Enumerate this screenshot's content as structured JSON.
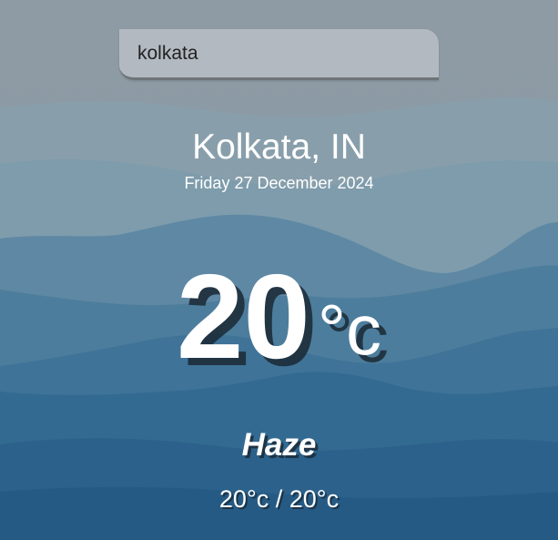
{
  "search": {
    "value": "kolkata"
  },
  "location": {
    "city": "Kolkata, IN",
    "date": "Friday 27 December 2024"
  },
  "weather": {
    "temperature": "20",
    "unit": "°c",
    "condition": "Haze",
    "hi_low": "20°c / 20°c"
  },
  "colors": {
    "text": "#ffffff",
    "search_bg": "#b6bcc4",
    "sky": "#8a99a4",
    "mountain_far": "#7f9aaa",
    "mountain_mid": "#4f7f9c",
    "mountain_near": "#2e6a93"
  }
}
